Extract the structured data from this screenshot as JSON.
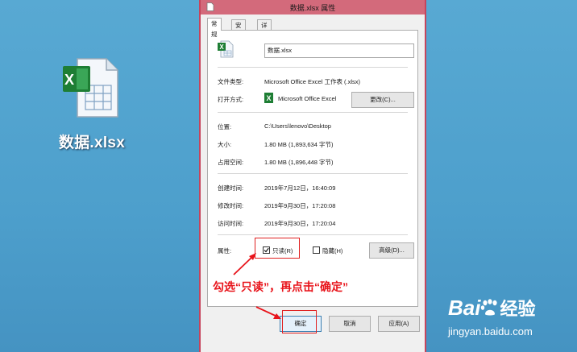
{
  "desktop": {
    "file_label": "数据.xlsx"
  },
  "dialog": {
    "title": "数据.xlsx 属性",
    "tabs": [
      "常规",
      "安全",
      "详细信息"
    ],
    "filename": "数据.xlsx",
    "file_type_label": "文件类型:",
    "file_type_value": "Microsoft Office Excel 工作表 (.xlsx)",
    "open_with_label": "打开方式:",
    "open_with_value": "Microsoft Office Excel",
    "change_button": "更改(C)...",
    "location_label": "位置:",
    "location_value": "C:\\Users\\lenovo\\Desktop",
    "size_label": "大小:",
    "size_value": "1.80 MB (1,893,634 字节)",
    "disk_size_label": "占用空间:",
    "disk_size_value": "1.80 MB (1,896,448 字节)",
    "created_label": "创建时间:",
    "created_value": "2019年7月12日，16:40:09",
    "modified_label": "修改时间:",
    "modified_value": "2019年9月30日，17:20:08",
    "accessed_label": "访问时间:",
    "accessed_value": "2019年9月30日，17:20:04",
    "attributes_label": "属性:",
    "readonly_label": "只读(R)",
    "readonly_checked": true,
    "hidden_label": "隐藏(H)",
    "hidden_checked": false,
    "advanced_button": "高级(D)...",
    "ok_button": "确定",
    "cancel_button": "取消",
    "apply_button": "应用(A)"
  },
  "annotation": {
    "text": "勾选“只读”，再点击“确定”",
    "color": "#e8141b"
  },
  "watermark": {
    "logo_text": "Bai",
    "logo_text2": "经验",
    "url": "jingyan.baidu.com"
  },
  "colors": {
    "desktop": "#4d9fcc",
    "titlebar": "#d36a7b",
    "border": "#c6455c",
    "excel_green": "#1e7e34"
  }
}
